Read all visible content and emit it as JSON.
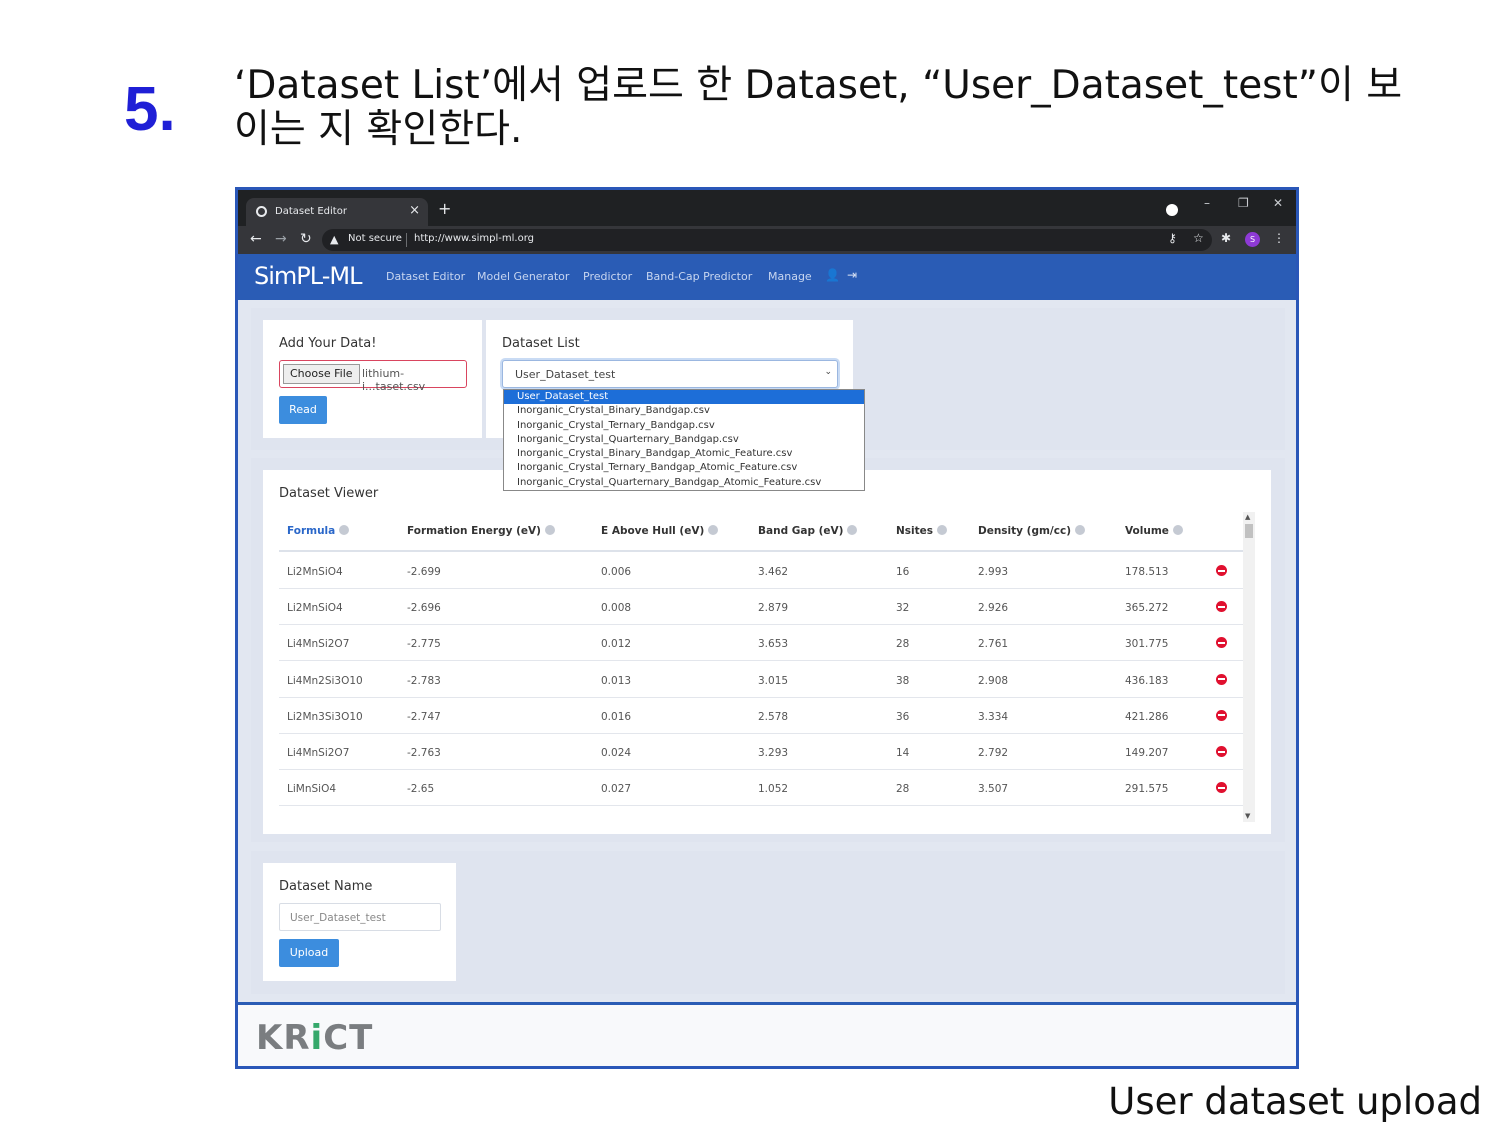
{
  "slide": {
    "step_number": "5.",
    "step_text": "‘Dataset List’에서 업로드 한 Dataset, “User_Dataset_test”이 보이는 지 확인한다.",
    "caption": "User dataset upload"
  },
  "browser": {
    "tab_title": "Dataset Editor",
    "new_tab": "+",
    "window_controls": [
      "–",
      "❐",
      "✕"
    ],
    "security_label": "Not secure",
    "url": "http://www.simpl-ml.org",
    "profile_initial": "S"
  },
  "navbar": {
    "brand": "SimPL-ML",
    "links": [
      "Dataset Editor",
      "Model Generator",
      "Predictor",
      "Band-Cap Predictor",
      "Manage"
    ]
  },
  "add_data": {
    "title": "Add Your Data!",
    "choose_file_label": "Choose File",
    "file_name": "lithium-i...taset.csv",
    "read_label": "Read"
  },
  "dataset_list": {
    "title": "Dataset List",
    "selected": "User_Dataset_test",
    "options": [
      "User_Dataset_test",
      "Inorganic_Crystal_Binary_Bandgap.csv",
      "Inorganic_Crystal_Ternary_Bandgap.csv",
      "Inorganic_Crystal_Quarternary_Bandgap.csv",
      "Inorganic_Crystal_Binary_Bandgap_Atomic_Feature.csv",
      "Inorganic_Crystal_Ternary_Bandgap_Atomic_Feature.csv",
      "Inorganic_Crystal_Quarternary_Bandgap_Atomic_Feature.csv"
    ]
  },
  "dataset_viewer": {
    "title": "Dataset Viewer",
    "columns": [
      "Formula",
      "Formation Energy (eV)",
      "E Above Hull (eV)",
      "Band Gap (eV)",
      "Nsites",
      "Density (gm/cc)",
      "Volume"
    ],
    "rows": [
      [
        "Li2MnSiO4",
        "-2.699",
        "0.006",
        "3.462",
        "16",
        "2.993",
        "178.513"
      ],
      [
        "Li2MnSiO4",
        "-2.696",
        "0.008",
        "2.879",
        "32",
        "2.926",
        "365.272"
      ],
      [
        "Li4MnSi2O7",
        "-2.775",
        "0.012",
        "3.653",
        "28",
        "2.761",
        "301.775"
      ],
      [
        "Li4Mn2Si3O10",
        "-2.783",
        "0.013",
        "3.015",
        "38",
        "2.908",
        "436.183"
      ],
      [
        "Li2Mn3Si3O10",
        "-2.747",
        "0.016",
        "2.578",
        "36",
        "3.334",
        "421.286"
      ],
      [
        "Li4MnSi2O7",
        "-2.763",
        "0.024",
        "3.293",
        "14",
        "2.792",
        "149.207"
      ],
      [
        "LiMnSiO4",
        "-2.65",
        "0.027",
        "1.052",
        "28",
        "3.507",
        "291.575"
      ]
    ]
  },
  "dataset_name": {
    "title": "Dataset Name",
    "value": "User_Dataset_test",
    "upload_label": "Upload"
  },
  "footer": {
    "logo_pre": "KR",
    "logo_i": "i",
    "logo_post": "CT"
  }
}
